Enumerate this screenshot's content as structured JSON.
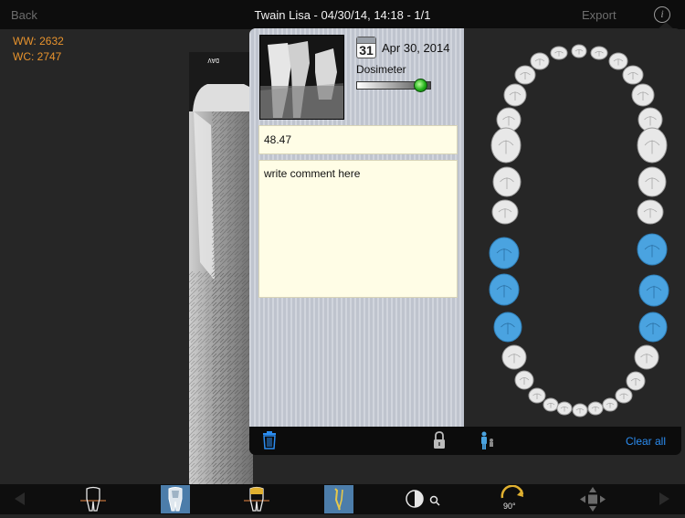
{
  "header": {
    "back_label": "Back",
    "title": "Twain Lisa - 04/30/14, 14:18 - 1/1",
    "export_label": "Export",
    "info_glyph": "i"
  },
  "window": {
    "ww_label": "WW: 2632",
    "wc_label": "WC: 2747"
  },
  "xray": {
    "marker_text": "DAV"
  },
  "detail": {
    "calendar_day": "31",
    "date": "Apr 30, 2014",
    "dosimeter_label": "Dosimeter",
    "dosimeter_level": 0.85,
    "value": "48.47",
    "comment_placeholder": "write comment here"
  },
  "chart": {
    "selected_teeth_color": "#4aa3e0",
    "tooth_color": "#e8e8e8"
  },
  "bottom": {
    "clear_all_label": "Clear all"
  },
  "toolbar": {
    "tools": [
      {
        "name": "tooth-outline-icon",
        "selected": false
      },
      {
        "name": "tooth-xray-icon",
        "selected": true
      },
      {
        "name": "tooth-crown-icon",
        "selected": false
      },
      {
        "name": "root-canal-icon",
        "selected": true
      },
      {
        "name": "contrast-magnify-icon",
        "selected": false
      },
      {
        "name": "rotate-90-icon",
        "selected": false
      },
      {
        "name": "move-icon",
        "selected": false
      }
    ],
    "rotate_label": "90°"
  },
  "colors": {
    "accent": "#e8932d",
    "link": "#2b8cf0",
    "selection": "#4c7daa"
  }
}
